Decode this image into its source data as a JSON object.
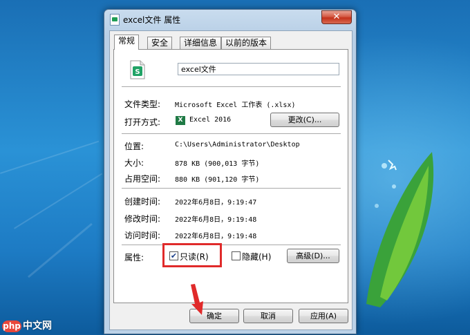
{
  "window": {
    "title": "excel文件 属性",
    "close_glyph": "✕"
  },
  "tabs": [
    {
      "label": "常规",
      "active": true
    },
    {
      "label": "安全",
      "active": false
    },
    {
      "label": "详细信息",
      "active": false
    },
    {
      "label": "以前的版本",
      "active": false
    }
  ],
  "general": {
    "file_name": "excel文件",
    "file_type_label": "文件类型:",
    "file_type_value": "Microsoft Excel 工作表 (.xlsx)",
    "open_with_label": "打开方式:",
    "open_with_value": "Excel 2016",
    "open_with_icon": "excel-app-icon",
    "change_button": "更改(C)...",
    "location_label": "位置:",
    "location_value": "C:\\Users\\Administrator\\Desktop",
    "size_label": "大小:",
    "size_value": "878 KB (900,013 字节)",
    "size_on_disk_label": "占用空间:",
    "size_on_disk_value": "880 KB (901,120 字节)",
    "created_label": "创建时间:",
    "created_value": "2022年6月8日，9:19:47",
    "modified_label": "修改时间:",
    "modified_value": "2022年6月8日，9:19:48",
    "accessed_label": "访问时间:",
    "accessed_value": "2022年6月8日，9:19:48",
    "attributes_label": "属性:",
    "readonly_label": "只读(R)",
    "readonly_checked": true,
    "hidden_label": "隐藏(H)",
    "hidden_checked": false,
    "advanced_button": "高级(D)..."
  },
  "footer": {
    "ok_button": "确定",
    "cancel_button": "取消",
    "apply_button": "应用(A)"
  },
  "watermark": {
    "logo_text": "php",
    "site_text": "中文网"
  },
  "colors": {
    "highlight": "#e02a2a",
    "desktop": "#1e7fc0",
    "excel_green": "#1f7a45"
  }
}
